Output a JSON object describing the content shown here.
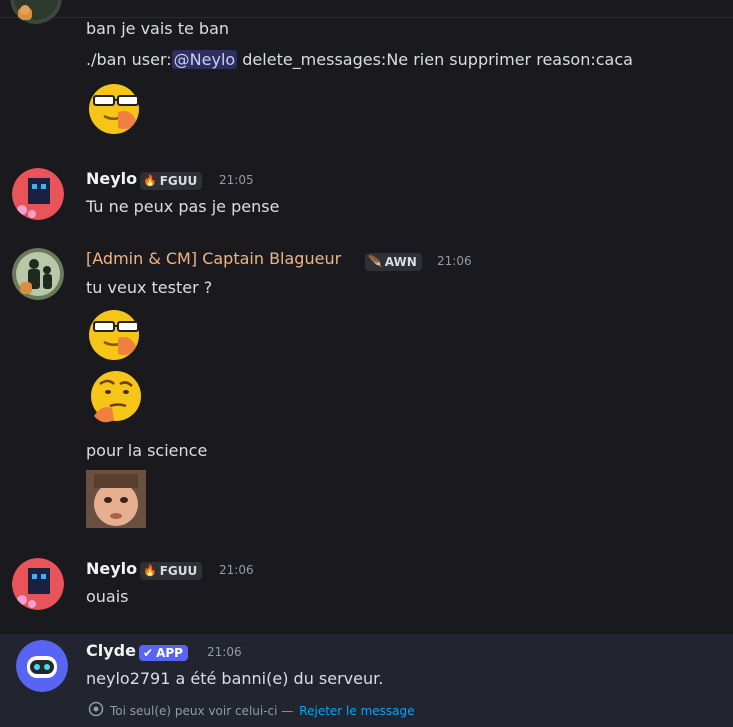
{
  "messages": {
    "m0": {
      "line1": "ban je vais te ban",
      "cmd_prefix": "./ban user:",
      "mention": "@Neylo",
      "cmd_suffix": " delete_messages:Ne rien supprimer reason:caca"
    },
    "m1": {
      "author": "Neylo",
      "tag": "FGUU",
      "tag_icon": "🔥",
      "time": "21:05",
      "text": "Tu ne peux pas je pense"
    },
    "m2": {
      "author": "[Admin & CM] Captain Blagueur",
      "tag": "AWN",
      "tag_icon": "🪶",
      "time": "21:06",
      "text1": "tu veux tester ?",
      "text2": "pour la science"
    },
    "m3": {
      "author": "Neylo",
      "tag": "FGUU",
      "tag_icon": "🔥",
      "time": "21:06",
      "text": "ouais"
    },
    "m4": {
      "author": "Clyde",
      "app_label": "APP",
      "time": "21:06",
      "text": "neylo2791 a été banni(e) du serveur.",
      "ephemeral_note": "Toi seul(e) peux voir celui-ci —",
      "dismiss_link": "Rejeter le message"
    }
  },
  "colors": {
    "background": "#1a1a1e",
    "admin_name": "#f0b482",
    "mention_bg": "#5865f2",
    "link": "#00a8fc",
    "app_badge": "#5865f2"
  },
  "icons": {
    "emoji_smirk": "smirking-glasses-emoji",
    "emoji_thinking": "thinking-emoji",
    "reaction_image": "child-face-image",
    "eye": "eye-icon",
    "verified": "checkmark-icon"
  }
}
